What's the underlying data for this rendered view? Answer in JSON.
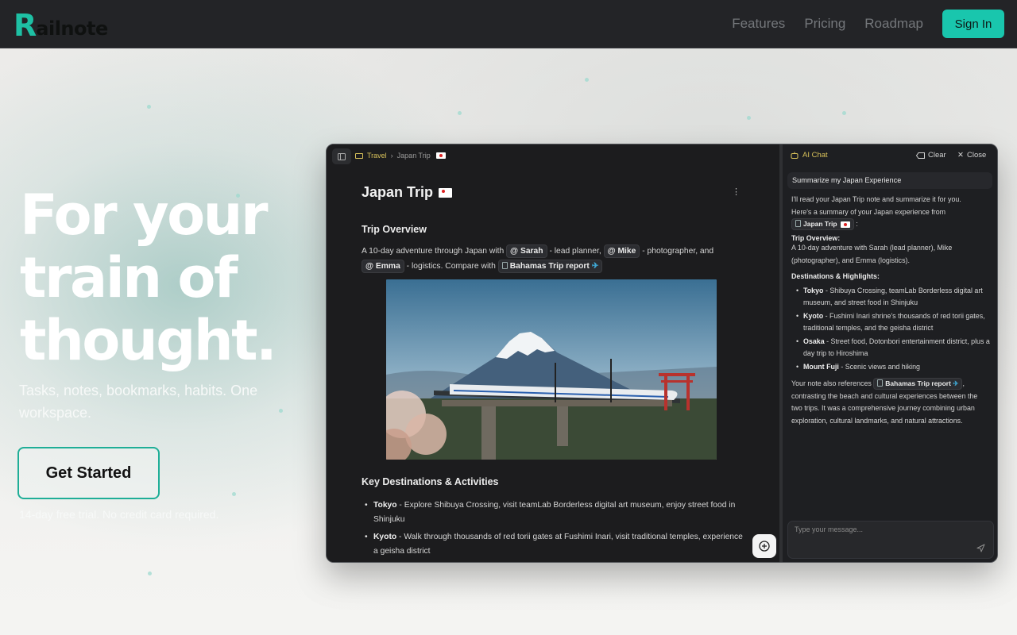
{
  "nav": {
    "logo_r": "R",
    "logo_text": "ailnote",
    "links": [
      "Features",
      "Pricing",
      "Roadmap"
    ],
    "signin": "Sign In"
  },
  "hero": {
    "title_lines": [
      "For your",
      "train of",
      "thought."
    ],
    "subtitle": "Tasks, notes, bookmarks, habits. One workspace.",
    "cta": "Get Started",
    "trial": "14-day free trial. No credit card required."
  },
  "app": {
    "breadcrumb": {
      "folder": "Travel",
      "page": "Japan Trip"
    },
    "doc": {
      "title": "Japan Trip",
      "overview_heading": "Trip Overview",
      "overview": {
        "t1": "A 10-day adventure through Japan with ",
        "sarah": "@ Sarah",
        "t2": " - lead planner, ",
        "mike": "@ Mike",
        "t3": " - photographer, and ",
        "emma": "@ Emma",
        "t4": " - logistics. Compare with ",
        "link": "Bahamas Trip report"
      },
      "destinations_heading": "Key Destinations & Activities",
      "destinations": [
        {
          "name": "Tokyo",
          "text": " - Explore Shibuya Crossing, visit teamLab Borderless digital art museum, enjoy street food in Shinjuku"
        },
        {
          "name": "Kyoto",
          "text": " - Walk through thousands of red torii gates at Fushimi Inari, visit traditional temples, experience a geisha district"
        }
      ]
    },
    "chat": {
      "title": "AI Chat",
      "clear": "Clear",
      "close": "Close",
      "user_message": "Summarize my Japan Experience",
      "reply": {
        "intro": "I'll read your Japan Trip note and summarize it for you.",
        "summary_lead": "Here's a summary of your Japan experience from",
        "note_chip": "Japan Trip",
        "colon": ":",
        "overview_heading": "Trip Overview:",
        "overview": "A 10-day adventure with Sarah (lead planner), Mike (photographer), and Emma (logistics).",
        "dest_heading": "Destinations & Highlights:",
        "dests": [
          {
            "name": "Tokyo",
            "text": " - Shibuya Crossing, teamLab Borderless digital art museum, and street food in Shinjuku"
          },
          {
            "name": "Kyoto",
            "text": " - Fushimi Inari shrine's thousands of red torii gates, traditional temples, and the geisha district"
          },
          {
            "name": "Osaka",
            "text": " - Street food, Dotonbori entertainment district, plus a day trip to Hiroshima"
          },
          {
            "name": "Mount Fuji",
            "text": " - Scenic views and hiking"
          }
        ],
        "closing_a": "Your note also references ",
        "closing_chip": "Bahamas Trip report",
        "closing_b": ", contrasting the beach and cultural experiences between the two trips. It was a comprehensive journey combining urban exploration, cultural landmarks, and natural attractions."
      },
      "input_placeholder": "Type your message..."
    }
  },
  "colors": {
    "accent": "#19c6ad",
    "nav_bg": "#232427",
    "app_bg": "#1c1c1e",
    "chat_accent": "#d9c25a"
  }
}
